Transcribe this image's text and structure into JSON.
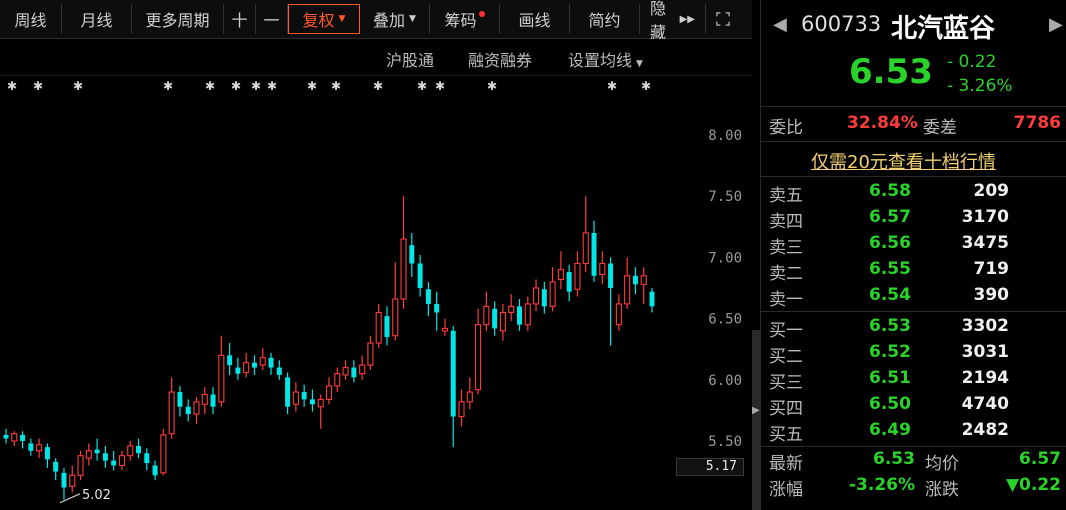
{
  "toolbar": {
    "items": [
      "周线",
      "月线",
      "更多周期",
      "十",
      "一",
      "复权",
      "叠加",
      "筹码",
      "画线",
      "简约",
      "隐藏"
    ],
    "expand_icon": "expand-icon",
    "active": "复权"
  },
  "sub_toolbar": {
    "hk_connect": "沪股通",
    "margin": "融资融券",
    "ma_settings": "设置均线"
  },
  "chart_data": {
    "type": "candlestick",
    "y_ticks": [
      "8.00",
      "7.50",
      "7.00",
      "6.50",
      "6.00",
      "5.50"
    ],
    "y_range": [
      5.0,
      8.0
    ],
    "last_price_label": "5.17",
    "low_marker": "5.02",
    "candles": [
      {
        "o": 5.55,
        "c": 5.52,
        "h": 5.6,
        "l": 5.48
      },
      {
        "o": 5.5,
        "c": 5.56,
        "h": 5.58,
        "l": 5.46
      },
      {
        "o": 5.55,
        "c": 5.5,
        "h": 5.58,
        "l": 5.44
      },
      {
        "o": 5.48,
        "c": 5.42,
        "h": 5.52,
        "l": 5.38
      },
      {
        "o": 5.42,
        "c": 5.47,
        "h": 5.52,
        "l": 5.36
      },
      {
        "o": 5.45,
        "c": 5.35,
        "h": 5.48,
        "l": 5.28
      },
      {
        "o": 5.33,
        "c": 5.25,
        "h": 5.36,
        "l": 5.18
      },
      {
        "o": 5.24,
        "c": 5.12,
        "h": 5.28,
        "l": 5.02
      },
      {
        "o": 5.13,
        "c": 5.22,
        "h": 5.3,
        "l": 5.08
      },
      {
        "o": 5.22,
        "c": 5.38,
        "h": 5.42,
        "l": 5.18
      },
      {
        "o": 5.36,
        "c": 5.42,
        "h": 5.48,
        "l": 5.3
      },
      {
        "o": 5.43,
        "c": 5.4,
        "h": 5.52,
        "l": 5.34
      },
      {
        "o": 5.4,
        "c": 5.34,
        "h": 5.46,
        "l": 5.28
      },
      {
        "o": 5.34,
        "c": 5.3,
        "h": 5.42,
        "l": 5.26
      },
      {
        "o": 5.3,
        "c": 5.38,
        "h": 5.42,
        "l": 5.26
      },
      {
        "o": 5.38,
        "c": 5.46,
        "h": 5.5,
        "l": 5.34
      },
      {
        "o": 5.46,
        "c": 5.4,
        "h": 5.52,
        "l": 5.36
      },
      {
        "o": 5.4,
        "c": 5.32,
        "h": 5.44,
        "l": 5.26
      },
      {
        "o": 5.3,
        "c": 5.22,
        "h": 5.34,
        "l": 5.18
      },
      {
        "o": 5.24,
        "c": 5.55,
        "h": 5.6,
        "l": 5.22
      },
      {
        "o": 5.56,
        "c": 5.9,
        "h": 6.02,
        "l": 5.52
      },
      {
        "o": 5.9,
        "c": 5.78,
        "h": 5.95,
        "l": 5.7
      },
      {
        "o": 5.78,
        "c": 5.72,
        "h": 5.84,
        "l": 5.66
      },
      {
        "o": 5.72,
        "c": 5.82,
        "h": 5.86,
        "l": 5.64
      },
      {
        "o": 5.8,
        "c": 5.88,
        "h": 5.94,
        "l": 5.72
      },
      {
        "o": 5.88,
        "c": 5.78,
        "h": 5.94,
        "l": 5.72
      },
      {
        "o": 5.82,
        "c": 6.2,
        "h": 6.36,
        "l": 5.78
      },
      {
        "o": 6.2,
        "c": 6.12,
        "h": 6.3,
        "l": 6.04
      },
      {
        "o": 6.1,
        "c": 6.05,
        "h": 6.18,
        "l": 6.0
      },
      {
        "o": 6.06,
        "c": 6.14,
        "h": 6.22,
        "l": 6.02
      },
      {
        "o": 6.14,
        "c": 6.1,
        "h": 6.2,
        "l": 6.04
      },
      {
        "o": 6.12,
        "c": 6.18,
        "h": 6.26,
        "l": 6.08
      },
      {
        "o": 6.18,
        "c": 6.1,
        "h": 6.22,
        "l": 6.04
      },
      {
        "o": 6.1,
        "c": 6.04,
        "h": 6.16,
        "l": 6.0
      },
      {
        "o": 6.02,
        "c": 5.78,
        "h": 6.06,
        "l": 5.72
      },
      {
        "o": 5.8,
        "c": 5.9,
        "h": 5.98,
        "l": 5.74
      },
      {
        "o": 5.9,
        "c": 5.84,
        "h": 5.96,
        "l": 5.78
      },
      {
        "o": 5.84,
        "c": 5.8,
        "h": 5.92,
        "l": 5.74
      },
      {
        "o": 5.78,
        "c": 5.84,
        "h": 5.88,
        "l": 5.6
      },
      {
        "o": 5.84,
        "c": 5.95,
        "h": 6.02,
        "l": 5.8
      },
      {
        "o": 5.95,
        "c": 6.05,
        "h": 6.1,
        "l": 5.9
      },
      {
        "o": 6.04,
        "c": 6.1,
        "h": 6.16,
        "l": 6.0
      },
      {
        "o": 6.1,
        "c": 6.02,
        "h": 6.16,
        "l": 5.98
      },
      {
        "o": 6.05,
        "c": 6.12,
        "h": 6.2,
        "l": 6.0
      },
      {
        "o": 6.12,
        "c": 6.3,
        "h": 6.36,
        "l": 6.08
      },
      {
        "o": 6.3,
        "c": 6.55,
        "h": 6.62,
        "l": 6.26
      },
      {
        "o": 6.52,
        "c": 6.35,
        "h": 6.6,
        "l": 6.28
      },
      {
        "o": 6.36,
        "c": 6.66,
        "h": 6.96,
        "l": 6.32
      },
      {
        "o": 6.66,
        "c": 7.15,
        "h": 7.5,
        "l": 6.58
      },
      {
        "o": 7.1,
        "c": 6.95,
        "h": 7.2,
        "l": 6.84
      },
      {
        "o": 6.95,
        "c": 6.75,
        "h": 7.02,
        "l": 6.68
      },
      {
        "o": 6.74,
        "c": 6.62,
        "h": 6.8,
        "l": 6.52
      },
      {
        "o": 6.62,
        "c": 6.55,
        "h": 6.72,
        "l": 6.4
      },
      {
        "o": 6.4,
        "c": 6.42,
        "h": 6.5,
        "l": 6.36
      },
      {
        "o": 6.4,
        "c": 5.7,
        "h": 6.44,
        "l": 5.45
      },
      {
        "o": 5.7,
        "c": 5.82,
        "h": 5.92,
        "l": 5.62
      },
      {
        "o": 5.82,
        "c": 5.9,
        "h": 6.02,
        "l": 5.76
      },
      {
        "o": 5.92,
        "c": 6.45,
        "h": 6.58,
        "l": 5.88
      },
      {
        "o": 6.45,
        "c": 6.6,
        "h": 6.72,
        "l": 6.4
      },
      {
        "o": 6.58,
        "c": 6.42,
        "h": 6.64,
        "l": 6.36
      },
      {
        "o": 6.4,
        "c": 6.55,
        "h": 6.62,
        "l": 6.32
      },
      {
        "o": 6.55,
        "c": 6.6,
        "h": 6.7,
        "l": 6.48
      },
      {
        "o": 6.6,
        "c": 6.45,
        "h": 6.66,
        "l": 6.4
      },
      {
        "o": 6.45,
        "c": 6.62,
        "h": 6.68,
        "l": 6.4
      },
      {
        "o": 6.62,
        "c": 6.75,
        "h": 6.82,
        "l": 6.56
      },
      {
        "o": 6.74,
        "c": 6.6,
        "h": 6.8,
        "l": 6.54
      },
      {
        "o": 6.6,
        "c": 6.8,
        "h": 6.92,
        "l": 6.56
      },
      {
        "o": 6.82,
        "c": 6.9,
        "h": 7.05,
        "l": 6.74
      },
      {
        "o": 6.88,
        "c": 6.72,
        "h": 6.94,
        "l": 6.64
      },
      {
        "o": 6.74,
        "c": 6.95,
        "h": 7.05,
        "l": 6.68
      },
      {
        "o": 6.95,
        "c": 7.2,
        "h": 7.5,
        "l": 6.88
      },
      {
        "o": 7.2,
        "c": 6.85,
        "h": 7.3,
        "l": 6.8
      },
      {
        "o": 6.86,
        "c": 6.95,
        "h": 7.05,
        "l": 6.78
      },
      {
        "o": 6.95,
        "c": 6.75,
        "h": 7.0,
        "l": 6.28
      },
      {
        "o": 6.45,
        "c": 6.62,
        "h": 6.7,
        "l": 6.4
      },
      {
        "o": 6.62,
        "c": 6.85,
        "h": 7.0,
        "l": 6.58
      },
      {
        "o": 6.85,
        "c": 6.78,
        "h": 6.92,
        "l": 6.7
      },
      {
        "o": 6.78,
        "c": 6.85,
        "h": 6.92,
        "l": 6.62
      },
      {
        "o": 6.72,
        "c": 6.6,
        "h": 6.75,
        "l": 6.55
      }
    ]
  },
  "quote": {
    "code": "600733",
    "name": "北汽蓝谷",
    "price": "6.53",
    "change": "- 0.22",
    "change_pct": "- 3.26%",
    "weibi_label": "委比",
    "weibi": "32.84%",
    "weicha_label": "委差",
    "weicha": "7786",
    "level2_link": "仅需20元查看十档行情"
  },
  "asks": [
    {
      "label": "卖五",
      "price": "6.58",
      "vol": "209"
    },
    {
      "label": "卖四",
      "price": "6.57",
      "vol": "3170"
    },
    {
      "label": "卖三",
      "price": "6.56",
      "vol": "3475"
    },
    {
      "label": "卖二",
      "price": "6.55",
      "vol": "719"
    },
    {
      "label": "卖一",
      "price": "6.54",
      "vol": "390"
    }
  ],
  "bids": [
    {
      "label": "买一",
      "price": "6.53",
      "vol": "3302"
    },
    {
      "label": "买二",
      "price": "6.52",
      "vol": "3031"
    },
    {
      "label": "买三",
      "price": "6.51",
      "vol": "2194"
    },
    {
      "label": "买四",
      "price": "6.50",
      "vol": "4740"
    },
    {
      "label": "买五",
      "price": "6.49",
      "vol": "2482"
    }
  ],
  "stats": {
    "latest_label": "最新",
    "latest": "6.53",
    "avg_label": "均价",
    "avg": "6.57",
    "pct_label": "涨幅",
    "pct": "-3.26%",
    "chg_label": "涨跌",
    "chg": "▼0.22"
  },
  "colors": {
    "up": "#ff3b3b",
    "down": "#00e5e5",
    "fall_text": "#2ad32a",
    "accent": "#ff5a2a",
    "link": "#f0d070"
  }
}
